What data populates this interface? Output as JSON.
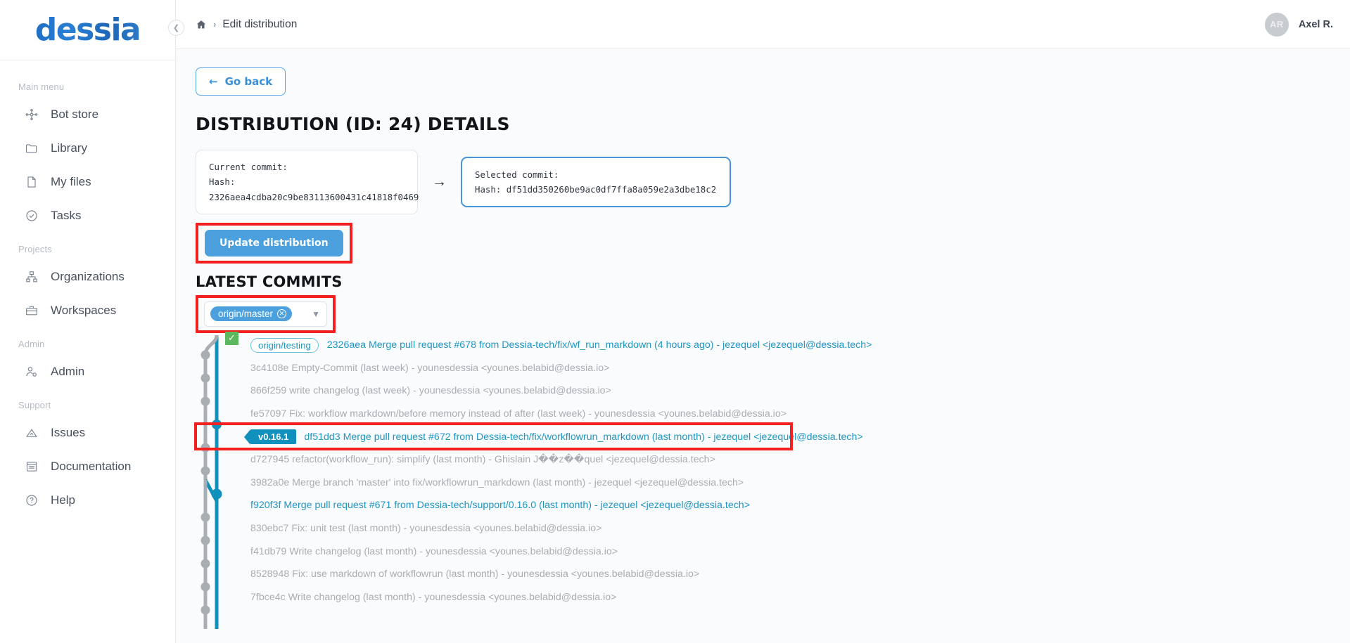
{
  "brand": {
    "name": "dessia"
  },
  "sidebar": {
    "collapse_icon": "chevron-left-icon",
    "sections": [
      {
        "label": "Main menu",
        "items": [
          {
            "label": "Bot store",
            "icon": "bot-store-icon"
          },
          {
            "label": "Library",
            "icon": "folder-icon"
          },
          {
            "label": "My files",
            "icon": "file-icon"
          },
          {
            "label": "Tasks",
            "icon": "check-circle-icon"
          }
        ]
      },
      {
        "label": "Projects",
        "items": [
          {
            "label": "Organizations",
            "icon": "sitemap-icon"
          },
          {
            "label": "Workspaces",
            "icon": "briefcase-icon"
          }
        ]
      },
      {
        "label": "Admin",
        "items": [
          {
            "label": "Admin",
            "icon": "user-gear-icon"
          }
        ]
      },
      {
        "label": "Support",
        "items": [
          {
            "label": "Issues",
            "icon": "warning-triangle-icon"
          },
          {
            "label": "Documentation",
            "icon": "book-icon"
          },
          {
            "label": "Help",
            "icon": "question-circle-icon"
          }
        ]
      }
    ]
  },
  "topbar": {
    "home_icon": "home-icon",
    "separator": "›",
    "breadcrumb": "Edit distribution",
    "user": {
      "initials": "AR",
      "name": "Axel R."
    }
  },
  "main": {
    "go_back": "Go back",
    "go_back_icon": "arrow-left-icon",
    "page_title": "DISTRIBUTION (ID: 24) DETAILS",
    "current_commit": {
      "label": "Current commit:",
      "hash": "Hash: 2326aea4cdba20c9be83113600431c41818f0469"
    },
    "arrow": "→",
    "selected_commit": {
      "label": "Selected commit:",
      "hash": "Hash: df51dd350260be9ac0df7ffa8a059e2a3dbe18c2"
    },
    "update_button": "Update distribution",
    "latest_commits_title": "LATEST COMMITS",
    "branch_filter": {
      "chip": "origin/master",
      "chip_remove_icon": "close-circle-icon",
      "caret_icon": "chevron-down-icon"
    }
  },
  "commits": [
    {
      "branch_tag": "origin/testing",
      "checked": true,
      "text": "2326aea Merge pull request #678 from Dessia-tech/fix/wf_run_markdown (4 hours ago) - jezequel <jezequel@dessia.tech>",
      "style": "link"
    },
    {
      "text": "3c4108e Empty-Commit (last week) - younesdessia <younes.belabid@dessia.io>",
      "style": "muted"
    },
    {
      "text": "866f259 write changelog (last week) - younesdessia <younes.belabid@dessia.io>",
      "style": "muted"
    },
    {
      "text": "fe57097 Fix: workflow markdown/before memory instead of after (last week) - younesdessia <younes.belabid@dessia.io>",
      "style": "muted"
    },
    {
      "version_tag": "v0.16.1",
      "text": "df51dd3 Merge pull request #672 from Dessia-tech/fix/workflowrun_markdown (last month) - jezequel <jezequel@dessia.tech>",
      "style": "link",
      "highlighted": true
    },
    {
      "text": "d727945 refactor(workflow_run): simplify (last month) - Ghislain J��z��quel <jezequel@dessia.tech>",
      "style": "muted"
    },
    {
      "text": "3982a0e Merge branch 'master' into fix/workflowrun_markdown (last month) - jezequel <jezequel@dessia.tech>",
      "style": "muted"
    },
    {
      "text": "f920f3f Merge pull request #671 from Dessia-tech/support/0.16.0 (last month) - jezequel <jezequel@dessia.tech>",
      "style": "link"
    },
    {
      "text": "830ebc7 Fix: unit test (last month) - younesdessia <younes.belabid@dessia.io>",
      "style": "muted"
    },
    {
      "text": "f41db79 Write changelog (last month) - younesdessia <younes.belabid@dessia.io>",
      "style": "muted"
    },
    {
      "text": "8528948 Fix: use markdown of workflowrun (last month) - younesdessia <younes.belabid@dessia.io>",
      "style": "muted"
    },
    {
      "text": "7fbce4c Write changelog (last month) - younesdessia <younes.belabid@dessia.io>",
      "style": "muted"
    }
  ],
  "colors": {
    "accent_blue": "#4ba0dd",
    "link_teal": "#2096c4",
    "graph_teal": "#1091bd",
    "graph_gray": "#a9aeb4",
    "highlight_red": "#f32020",
    "check_green": "#5cb85c"
  }
}
